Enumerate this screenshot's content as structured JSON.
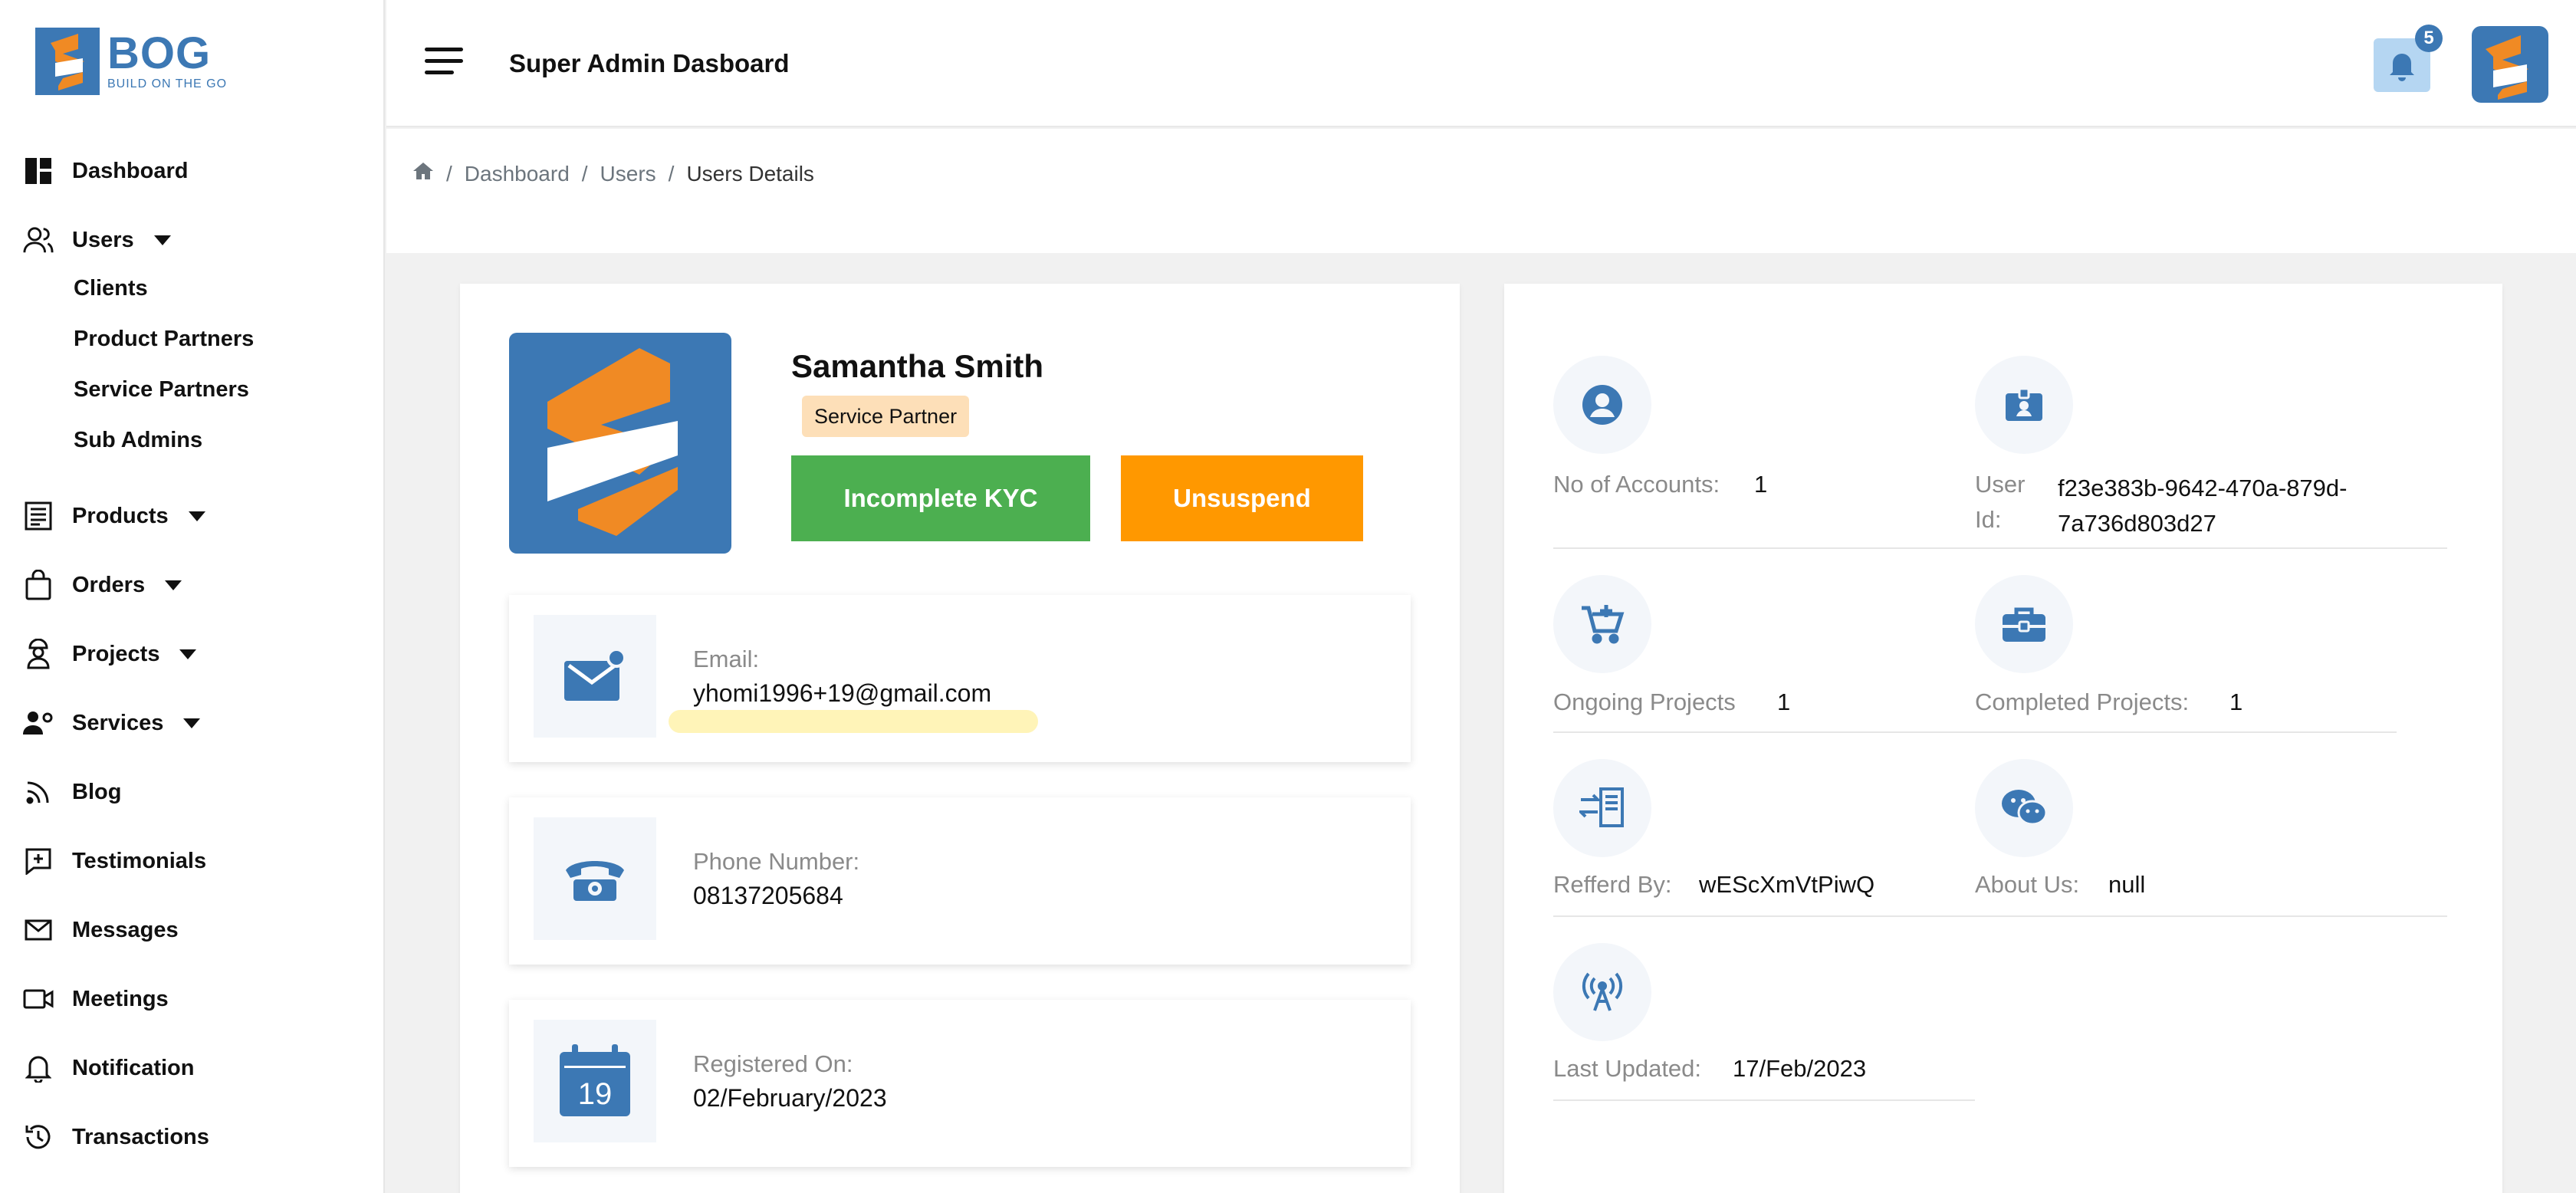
{
  "brand": {
    "name": "BOG",
    "tagline": "BUILD ON THE GO"
  },
  "colors": {
    "primary": "#3c78b4",
    "accent_orange": "#ff9800",
    "success_green": "#4caf50",
    "badge_bg": "#fddfb8"
  },
  "sidebar": {
    "dashboard": "Dashboard",
    "users": "Users",
    "users_sub": [
      "Clients",
      "Product Partners",
      "Service Partners",
      "Sub Admins"
    ],
    "products": "Products",
    "orders": "Orders",
    "projects": "Projects",
    "services": "Services",
    "blog": "Blog",
    "testimonials": "Testimonials",
    "messages": "Messages",
    "meetings": "Meetings",
    "notification": "Notification",
    "transactions": "Transactions"
  },
  "header": {
    "title": "Super Admin Dasboard",
    "notification_count": "5"
  },
  "breadcrumb": {
    "items": [
      "Dashboard",
      "Users",
      "Users Details"
    ]
  },
  "profile": {
    "name": "Samantha Smith",
    "role": "Service Partner",
    "kyc_button": "Incomplete KYC",
    "suspend_button": "Unsuspend",
    "email_label": "Email:",
    "email": "yhomi1996+19@gmail.com",
    "phone_label": "Phone Number:",
    "phone": "08137205684",
    "registered_label": "Registered On:",
    "registered": "02/February/2023",
    "calendar_day": "19"
  },
  "stats": {
    "accounts_label": "No of Accounts:",
    "accounts": "1",
    "user_id_label_1": "User",
    "user_id_label_2": "Id:",
    "user_id_1": "f23e383b-9642-470a-879d-",
    "user_id_2": "7a736d803d27",
    "ongoing_label": "Ongoing Projects",
    "ongoing": "1",
    "completed_label": "Completed Projects:",
    "completed": "1",
    "referred_label": "Refferd By:",
    "referred": "wEScXmVtPiwQ",
    "about_label": "About Us:",
    "about": "null",
    "updated_label": "Last Updated:",
    "updated": "17/Feb/2023"
  }
}
